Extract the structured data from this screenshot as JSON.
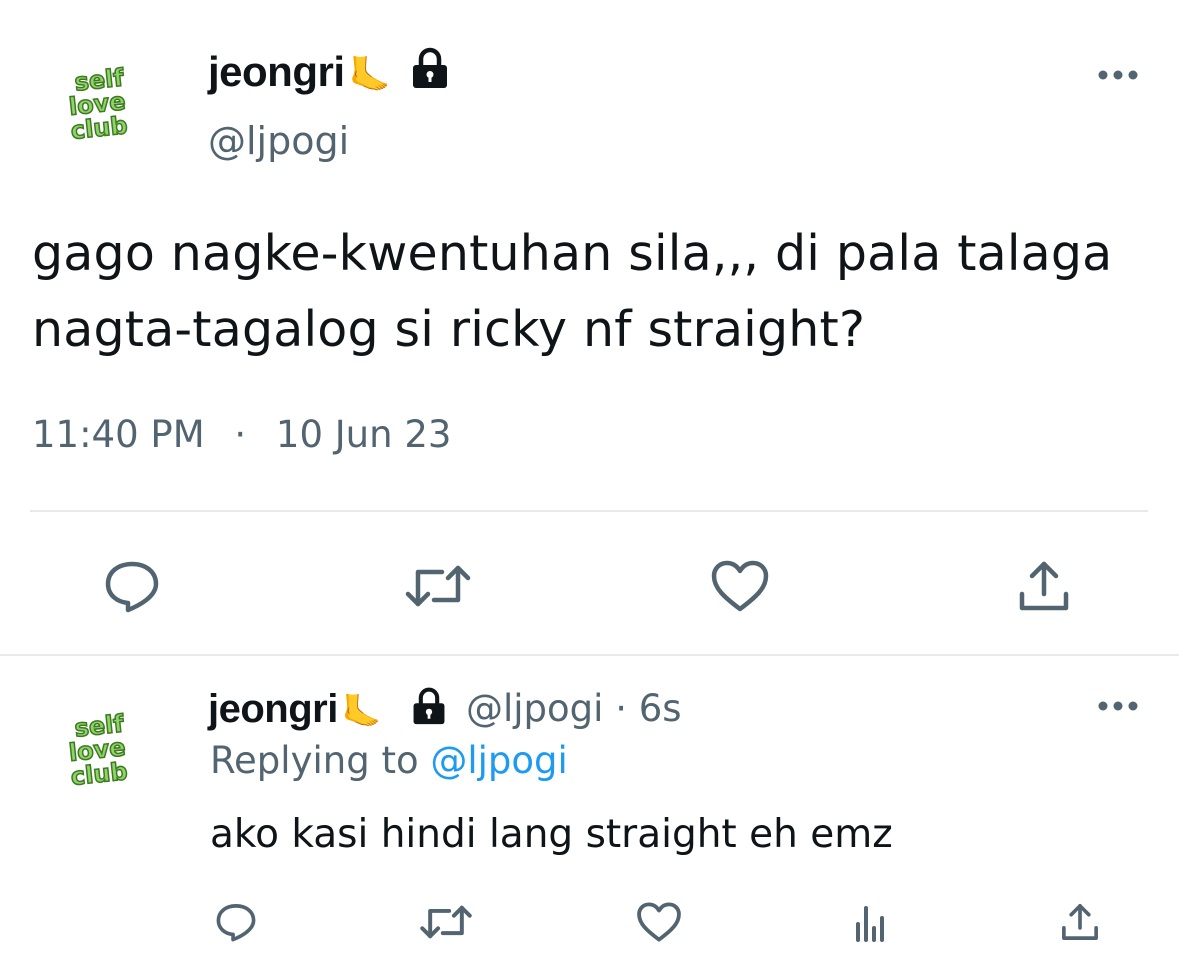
{
  "main_tweet": {
    "avatar_text": [
      "self",
      "love",
      "club"
    ],
    "display_name": "jeongri",
    "name_emoji": "🦶",
    "handle": "@ljpogi",
    "text_line1": "gago nagke-kwentuhan sila,,, di pala talaga",
    "text_line2": "nagta-tagalog si ricky nf straight?",
    "time": "11:40 PM",
    "separator": "·",
    "date": "10 Jun 23"
  },
  "reply_tweet": {
    "avatar_text": [
      "self",
      "love",
      "club"
    ],
    "display_name": "jeongri",
    "name_emoji": "🦶",
    "handle": "@ljpogi",
    "separator": "·",
    "age": "6s",
    "replying_prefix": "Replying to",
    "replying_handle": "@ljpogi",
    "text": "ako kasi hindi lang straight eh emz"
  },
  "colors": {
    "text": "#0f1419",
    "muted": "#536471",
    "accent": "#1d9bf0",
    "avatar_green": "#8fd36b",
    "avatar_dark": "#3d7a1f"
  }
}
